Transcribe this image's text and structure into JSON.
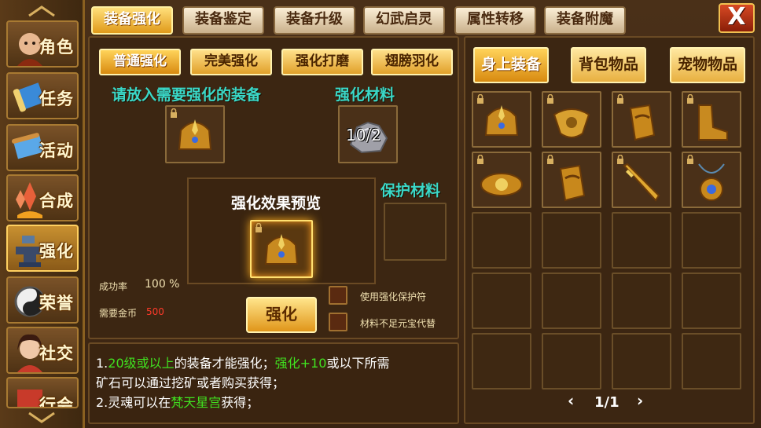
{
  "nav": {
    "items": [
      {
        "label": "角色",
        "icon": "warrior-portrait-icon"
      },
      {
        "label": "任务",
        "icon": "scroll-icon"
      },
      {
        "label": "活动",
        "icon": "banner-scroll-icon"
      },
      {
        "label": "合成",
        "icon": "crystal-fire-icon"
      },
      {
        "label": "强化",
        "icon": "anvil-icon"
      },
      {
        "label": "荣誉",
        "icon": "yin-yang-icon"
      },
      {
        "label": "社交",
        "icon": "female-portrait-icon"
      },
      {
        "label": "行会",
        "icon": "guild-icon"
      }
    ],
    "active_index": 4
  },
  "tabs": [
    "装备强化",
    "装备鉴定",
    "装备升级",
    "幻武启灵",
    "属性转移",
    "装备附魔"
  ],
  "active_tab": 0,
  "close_label": "X",
  "forge": {
    "subtabs": [
      "普通强化",
      "完美强化",
      "强化打磨",
      "翅膀羽化"
    ],
    "place_equip_label": "请放入需要强化的装备",
    "material_label": "强化材料",
    "material_count": "10/2",
    "preview_label": "强化效果预览",
    "protect_label": "保护材料",
    "success_rate_label": "成功率",
    "success_rate_value": "100 %",
    "gold_label": "需要金币",
    "gold_value": "500",
    "enhance_button": "强化",
    "use_protect_label": "使用强化保护符",
    "ingot_replace_label": "材料不足元宝代替"
  },
  "info": {
    "l1a": "1.",
    "l1b": "20级或以上",
    "l1c": "的装备才能强化；",
    "l1d": "强化+10",
    "l1e": "或以下所需",
    "l2": "矿石可以通过挖矿或者购买获得；",
    "l3a": "2.灵魂可以在",
    "l3b": "梵天星宫",
    "l3c": "获得；"
  },
  "inventory": {
    "tabs": [
      "身上装备",
      "背包物品",
      "宠物物品"
    ],
    "active_tab": 0,
    "items": [
      "helmet-icon",
      "amulet-icon",
      "bracer-icon",
      "boots-icon",
      "belt-icon",
      "bracer-icon",
      "sword-icon",
      "necklace-icon"
    ],
    "page": "1/1"
  },
  "colors": {
    "accent_gold": "#e0a02a",
    "highlight_green": "#40e020",
    "label_cyan": "#3ad8c8",
    "gold_red": "#ff3a2a"
  }
}
